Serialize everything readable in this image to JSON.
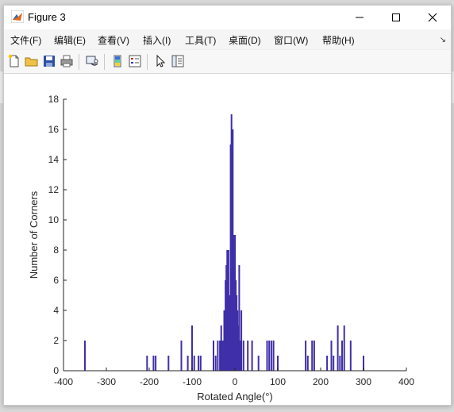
{
  "window": {
    "title": "Figure 3"
  },
  "menu": [
    "文件(F)",
    "编辑(E)",
    "查看(V)",
    "插入(I)",
    "工具(T)",
    "桌面(D)",
    "窗口(W)",
    "帮助(H)"
  ],
  "toolbar_icons": [
    "new-figure-icon",
    "open-file-icon",
    "save-icon",
    "print-icon",
    "link-plot-icon",
    "insert-colorbar-icon",
    "insert-legend-icon",
    "edit-plot-arrow-icon",
    "property-inspector-icon"
  ],
  "colors": {
    "bar": "#3f2fa8",
    "axes": "#262626",
    "figure_bg": "#ffffff"
  },
  "chart_data": {
    "type": "bar",
    "title": "",
    "xlabel": "Rotated Angle(°)",
    "ylabel": "Number of Corners",
    "xlim": [
      -400,
      400
    ],
    "ylim": [
      0,
      18
    ],
    "xticks": [
      -400,
      -300,
      -200,
      -100,
      0,
      100,
      200,
      300,
      400
    ],
    "yticks": [
      0,
      2,
      4,
      6,
      8,
      10,
      12,
      14,
      16,
      18
    ],
    "grid": false,
    "bar_width": 3,
    "x": [
      -350,
      -205,
      -190,
      -185,
      -155,
      -125,
      -110,
      -100,
      -95,
      -85,
      -80,
      -50,
      -45,
      -40,
      -35,
      -32,
      -30,
      -28,
      -25,
      -22,
      -20,
      -18,
      -15,
      -12,
      -10,
      -8,
      -5,
      -3,
      0,
      2,
      4,
      6,
      8,
      10,
      12,
      15,
      20,
      30,
      40,
      55,
      75,
      80,
      85,
      90,
      100,
      165,
      170,
      180,
      185,
      215,
      225,
      230,
      240,
      245,
      250,
      255,
      270,
      300
    ],
    "values": [
      2,
      1,
      1,
      1,
      1,
      2,
      1,
      3,
      1,
      1,
      1,
      2,
      1,
      2,
      2,
      3,
      2,
      2,
      4,
      6,
      7,
      8,
      8,
      5,
      15,
      17,
      16,
      9,
      9,
      6,
      5,
      4,
      3,
      7,
      2,
      4,
      2,
      2,
      2,
      1,
      2,
      2,
      2,
      2,
      1,
      2,
      1,
      2,
      2,
      1,
      2,
      1,
      3,
      1,
      2,
      3,
      2,
      1
    ]
  }
}
